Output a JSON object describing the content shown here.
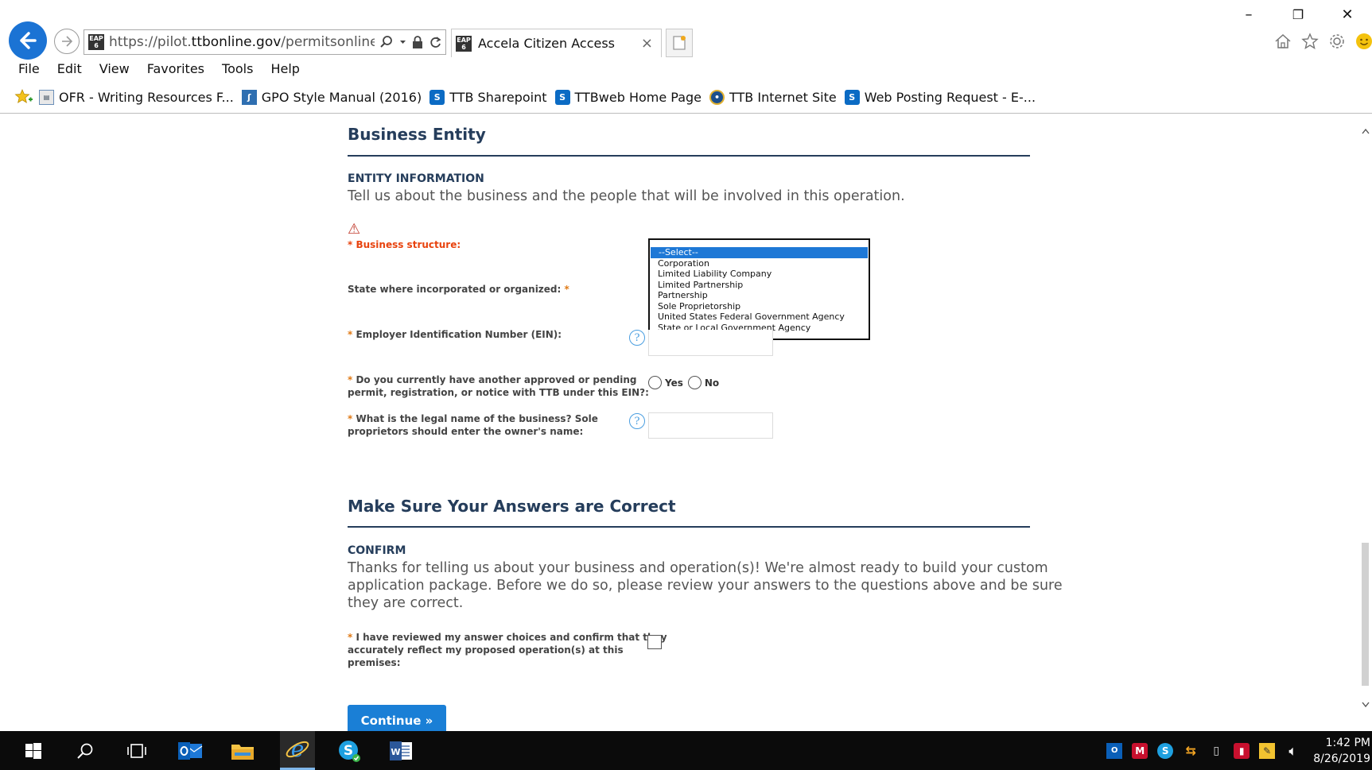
{
  "window": {
    "minimize": "–",
    "restore": "❐",
    "close": "✕"
  },
  "address_bar": {
    "url_prefix": "https://pilot.",
    "url_host": "ttbonline.gov",
    "url_path": "/permitsonline/Cap",
    "site_icon_text": "EAP 6"
  },
  "tab": {
    "title": "Accela Citizen Access",
    "close": "×"
  },
  "menu": [
    "File",
    "Edit",
    "View",
    "Favorites",
    "Tools",
    "Help"
  ],
  "favorites": [
    {
      "label": "OFR - Writing Resources F...",
      "icon": "ofr-icon"
    },
    {
      "label": "GPO Style Manual (2016)",
      "icon": "gpo-icon"
    },
    {
      "label": "TTB Sharepoint",
      "icon": "sharepoint-icon"
    },
    {
      "label": "TTBweb Home Page",
      "icon": "sharepoint-icon"
    },
    {
      "label": "TTB Internet Site",
      "icon": "ttb-seal-icon"
    },
    {
      "label": "Web Posting Request - E-...",
      "icon": "sharepoint-icon"
    }
  ],
  "business_entity": {
    "heading": "Business Entity",
    "subheading": "ENTITY INFORMATION",
    "intro": "Tell us about the business and the people that will be involved in this operation.",
    "business_structure_label": "Business structure:",
    "state_label": "State where incorporated or organized:",
    "ein_label": "Employer Identification Number (EIN):",
    "pending_label_line1": "Do you currently have another approved or pending",
    "pending_label_line2": "permit, registration, or notice with TTB under this EIN?:",
    "yes": "Yes",
    "no": "No",
    "legal_name_label_line1": "What is the legal name of the business? Sole",
    "legal_name_label_line2": "proprietors should enter the owner's name:",
    "required_mark": "*",
    "help_mark": "?",
    "warning_mark": "⚠"
  },
  "structure_options": [
    "--Select--",
    "Corporation",
    "Limited Liability Company",
    "Limited Partnership",
    "Partnership",
    "Sole Proprietorship",
    "United States Federal Government Agency",
    "State or Local Government Agency"
  ],
  "confirm": {
    "heading": "Make Sure Your Answers are Correct",
    "subheading": "CONFIRM",
    "line1": "Thanks for telling us about your business and operation(s)! We're almost ready to build your custom",
    "line2": "application package. Before we do so, please review your answers to the questions above and be sure",
    "line3": "they are correct.",
    "check_label_line1": "I have reviewed my answer choices and confirm that they",
    "check_label_line2": "accurately reflect my proposed operation(s) at this",
    "check_label_line3": "premises:",
    "continue": "Continue »"
  },
  "taskbar": {
    "time": "1:42 PM",
    "date": "8/26/2019"
  },
  "colors": {
    "accent_blue": "#1a7fd6",
    "heading_navy": "#253d5b",
    "required_orange": "#e07a16",
    "error_red": "#e8430e"
  }
}
